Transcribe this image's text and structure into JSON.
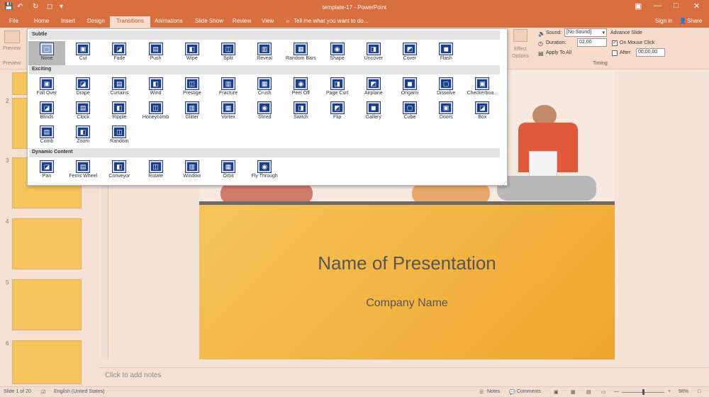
{
  "window": {
    "title": "template-17 - PowerPoint",
    "sign_in": "Sign in",
    "share": "Share"
  },
  "tabs": [
    "File",
    "Home",
    "Insert",
    "Design",
    "Transitions",
    "Animations",
    "Slide Show",
    "Review",
    "View"
  ],
  "tell_me": "Tell me what you want to do...",
  "ribbon": {
    "preview_label": "Preview",
    "preview_group": "Preview",
    "effect_options": "Effect Options",
    "timing_group": "Timing",
    "sound_label": "Sound:",
    "sound_value": "[No Sound]",
    "duration_label": "Duration:",
    "duration_value": "02,00",
    "apply_to_all": "Apply To All",
    "advance_slide": "Advance Slide",
    "on_mouse_click": "On Mouse Click",
    "after_label": "After:",
    "after_value": "00:00,00"
  },
  "gallery": {
    "sections": [
      {
        "title": "Subtle",
        "items": [
          "None",
          "Cut",
          "Fade",
          "Push",
          "Wipe",
          "Split",
          "Reveal",
          "Random Bars",
          "Shape",
          "Uncover",
          "Cover",
          "Flash"
        ]
      },
      {
        "title": "Exciting",
        "items": [
          "Fall Over",
          "Drape",
          "Curtains",
          "Wind",
          "Prestige",
          "Fracture",
          "Crush",
          "Peel Off",
          "Page Curl",
          "Airplane",
          "Origami",
          "Dissolve",
          "Checkerboa...",
          "Blinds",
          "Clock",
          "Ripple",
          "Honeycomb",
          "Glitter",
          "Vortex",
          "Shred",
          "Switch",
          "Flip",
          "Gallery",
          "Cube",
          "Doors",
          "Box",
          "Comb",
          "Zoom",
          "Random"
        ]
      },
      {
        "title": "Dynamic Content",
        "items": [
          "Pan",
          "Ferris Wheel",
          "Conveyor",
          "Rotate",
          "Window",
          "Orbit",
          "Fly Through"
        ]
      }
    ],
    "selected": "None"
  },
  "slide_numbers": [
    "2",
    "3",
    "4",
    "5",
    "6"
  ],
  "slide": {
    "title": "Name of Presentation",
    "subtitle": "Company Name"
  },
  "notes_placeholder": "Click to add notes",
  "status": {
    "slide_of": "Slide 1 of 20",
    "language": "English (United States)",
    "notes": "Notes",
    "comments": "Comments",
    "zoom": "98%"
  }
}
